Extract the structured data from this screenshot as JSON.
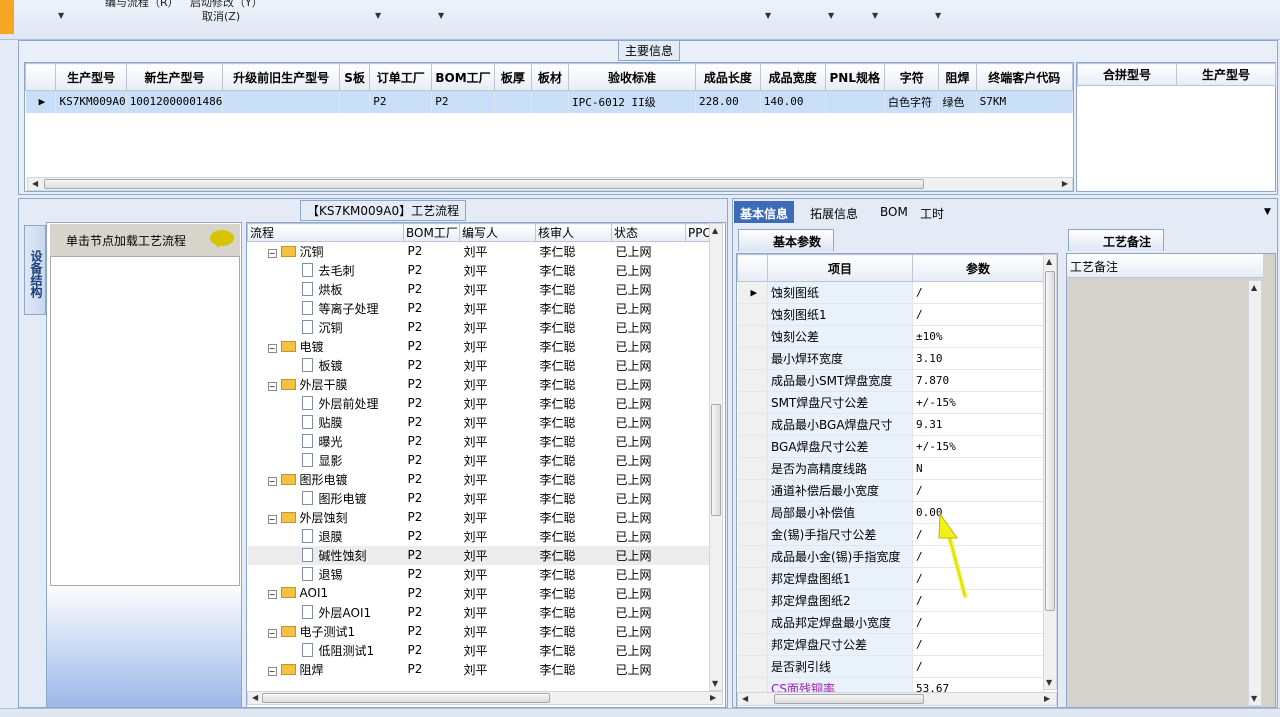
{
  "toolbar": {
    "partial_text_1": "编与流程（R）",
    "partial_text_2": "启动修改（Y）",
    "cancel_label": "取消(Z)"
  },
  "main_info": {
    "title": "主要信息",
    "columns": [
      "生产型号",
      "新生产型号",
      "升级前旧生产型号",
      "S板",
      "订单工厂",
      "BOM工厂",
      "板厚",
      "板材",
      "验收标准",
      "成品长度",
      "成品宽度",
      "PNL规格",
      "字符",
      "阻焊",
      "终端客户代码"
    ],
    "rows": [
      [
        "KS7KM009A0",
        "10012000001486",
        "",
        "",
        "P2",
        "P2",
        "",
        "",
        "IPC-6012 II级",
        "228.00",
        "140.00",
        "",
        "白色字符",
        "绿色",
        "S7KM"
      ]
    ],
    "merge_columns": [
      "合拼型号",
      "生产型号"
    ]
  },
  "process": {
    "title": "【KS7KM009A0】工艺流程",
    "equipment_tab": "设备结构",
    "equipment_hint": "单击节点加载工艺流程",
    "columns": [
      "流程",
      "BOM工厂",
      "编写人",
      "核审人",
      "状态",
      "PPC"
    ],
    "rows": [
      {
        "level": 0,
        "type": "folder",
        "name": "沉铜",
        "bom": "P2",
        "writer": "刘平",
        "reviewer": "李仁聪",
        "status": "已上网"
      },
      {
        "level": 1,
        "type": "doc",
        "name": "去毛刺",
        "bom": "P2",
        "writer": "刘平",
        "reviewer": "李仁聪",
        "status": "已上网"
      },
      {
        "level": 1,
        "type": "doc",
        "name": "烘板",
        "bom": "P2",
        "writer": "刘平",
        "reviewer": "李仁聪",
        "status": "已上网"
      },
      {
        "level": 1,
        "type": "doc",
        "name": "等离子处理",
        "bom": "P2",
        "writer": "刘平",
        "reviewer": "李仁聪",
        "status": "已上网"
      },
      {
        "level": 1,
        "type": "doc",
        "name": "沉铜",
        "bom": "P2",
        "writer": "刘平",
        "reviewer": "李仁聪",
        "status": "已上网"
      },
      {
        "level": 0,
        "type": "folder",
        "name": "电镀",
        "bom": "P2",
        "writer": "刘平",
        "reviewer": "李仁聪",
        "status": "已上网"
      },
      {
        "level": 1,
        "type": "doc",
        "name": "板镀",
        "bom": "P2",
        "writer": "刘平",
        "reviewer": "李仁聪",
        "status": "已上网"
      },
      {
        "level": 0,
        "type": "folder",
        "name": "外层干膜",
        "bom": "P2",
        "writer": "刘平",
        "reviewer": "李仁聪",
        "status": "已上网"
      },
      {
        "level": 1,
        "type": "doc",
        "name": "外层前处理",
        "bom": "P2",
        "writer": "刘平",
        "reviewer": "李仁聪",
        "status": "已上网"
      },
      {
        "level": 1,
        "type": "doc",
        "name": "贴膜",
        "bom": "P2",
        "writer": "刘平",
        "reviewer": "李仁聪",
        "status": "已上网"
      },
      {
        "level": 1,
        "type": "doc",
        "name": "曝光",
        "bom": "P2",
        "writer": "刘平",
        "reviewer": "李仁聪",
        "status": "已上网"
      },
      {
        "level": 1,
        "type": "doc",
        "name": "显影",
        "bom": "P2",
        "writer": "刘平",
        "reviewer": "李仁聪",
        "status": "已上网"
      },
      {
        "level": 0,
        "type": "folder",
        "name": "图形电镀",
        "bom": "P2",
        "writer": "刘平",
        "reviewer": "李仁聪",
        "status": "已上网"
      },
      {
        "level": 1,
        "type": "doc",
        "name": "图形电镀",
        "bom": "P2",
        "writer": "刘平",
        "reviewer": "李仁聪",
        "status": "已上网"
      },
      {
        "level": 0,
        "type": "folder",
        "name": "外层蚀刻",
        "bom": "P2",
        "writer": "刘平",
        "reviewer": "李仁聪",
        "status": "已上网"
      },
      {
        "level": 1,
        "type": "doc",
        "name": "退膜",
        "bom": "P2",
        "writer": "刘平",
        "reviewer": "李仁聪",
        "status": "已上网"
      },
      {
        "level": 1,
        "type": "doc",
        "name": "碱性蚀刻",
        "bom": "P2",
        "writer": "刘平",
        "reviewer": "李仁聪",
        "status": "已上网",
        "highlight": true
      },
      {
        "level": 1,
        "type": "doc",
        "name": "退锡",
        "bom": "P2",
        "writer": "刘平",
        "reviewer": "李仁聪",
        "status": "已上网"
      },
      {
        "level": 0,
        "type": "folder",
        "name": "AOI1",
        "bom": "P2",
        "writer": "刘平",
        "reviewer": "李仁聪",
        "status": "已上网"
      },
      {
        "level": 1,
        "type": "doc",
        "name": "外层AOI1",
        "bom": "P2",
        "writer": "刘平",
        "reviewer": "李仁聪",
        "status": "已上网"
      },
      {
        "level": 0,
        "type": "folder",
        "name": "电子测试1",
        "bom": "P2",
        "writer": "刘平",
        "reviewer": "李仁聪",
        "status": "已上网"
      },
      {
        "level": 1,
        "type": "doc",
        "name": "低阻测试1",
        "bom": "P2",
        "writer": "刘平",
        "reviewer": "李仁聪",
        "status": "已上网"
      },
      {
        "level": 0,
        "type": "folder",
        "name": "阻焊",
        "bom": "P2",
        "writer": "刘平",
        "reviewer": "李仁聪",
        "status": "已上网"
      }
    ]
  },
  "tabs": [
    "基本信息",
    "拓展信息",
    "BOM",
    "工时"
  ],
  "basic_params": {
    "subtab": "基本参数",
    "columns": [
      "项目",
      "参数"
    ],
    "rows": [
      {
        "item": "蚀刻图纸",
        "value": "/",
        "selected": true
      },
      {
        "item": "蚀刻图纸1",
        "value": "/"
      },
      {
        "item": "蚀刻公差",
        "value": "±10%"
      },
      {
        "item": "最小焊环宽度",
        "value": "3.10"
      },
      {
        "item": "成品最小SMT焊盘宽度",
        "value": "7.870"
      },
      {
        "item": "SMT焊盘尺寸公差",
        "value": "+/-15%"
      },
      {
        "item": "成品最小BGA焊盘尺寸",
        "value": "9.31"
      },
      {
        "item": "BGA焊盘尺寸公差",
        "value": "+/-15%"
      },
      {
        "item": "是否为高精度线路",
        "value": "N"
      },
      {
        "item": "通道补偿后最小宽度",
        "value": "/"
      },
      {
        "item": "局部最小补偿值",
        "value": "0.00"
      },
      {
        "item": "金(锡)手指尺寸公差",
        "value": "/"
      },
      {
        "item": "成品最小金(锡)手指宽度",
        "value": "/"
      },
      {
        "item": "邦定焊盘图纸1",
        "value": "/"
      },
      {
        "item": "邦定焊盘图纸2",
        "value": "/"
      },
      {
        "item": "成品邦定焊盘最小宽度",
        "value": "/"
      },
      {
        "item": "邦定焊盘尺寸公差",
        "value": "/"
      },
      {
        "item": "是否剥引线",
        "value": "/"
      },
      {
        "item": "CS面残铜率",
        "value": "53.67",
        "purple": true
      }
    ]
  },
  "notes": {
    "subtab": "工艺备注",
    "column": "工艺备注"
  },
  "colors": {
    "accent": "#3d6bb7",
    "selection": "#c9dff7",
    "annotation_arrow": "#f2f21a"
  }
}
